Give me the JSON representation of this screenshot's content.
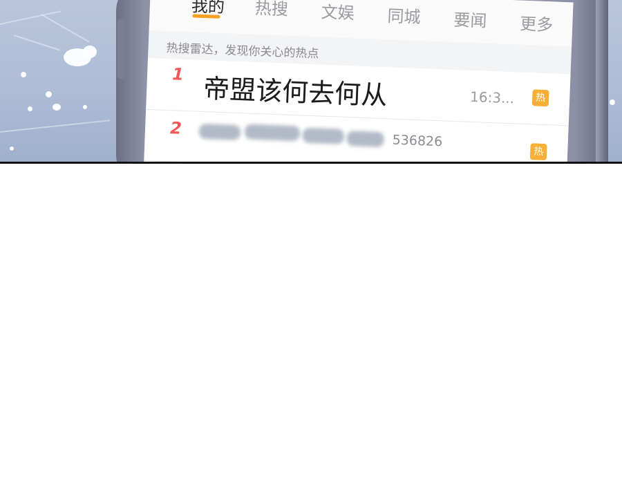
{
  "tabs": {
    "items": [
      "我的",
      "热搜",
      "文娱",
      "同城",
      "要闻",
      "更多"
    ],
    "active_index": 0
  },
  "radar_text": "热搜雷达，发现你关心的热点",
  "hot_list": [
    {
      "rank": "1",
      "title": "帝盟该何去何从",
      "meta": "16:3...",
      "badge": "热"
    },
    {
      "rank": "2",
      "title_blurred": true,
      "meta": "536826",
      "badge": "热"
    }
  ],
  "colors": {
    "accent": "#f7a021",
    "rank_red": "#ee5a5a",
    "badge_orange": "#f7b037",
    "sky": "#aebcd6"
  }
}
